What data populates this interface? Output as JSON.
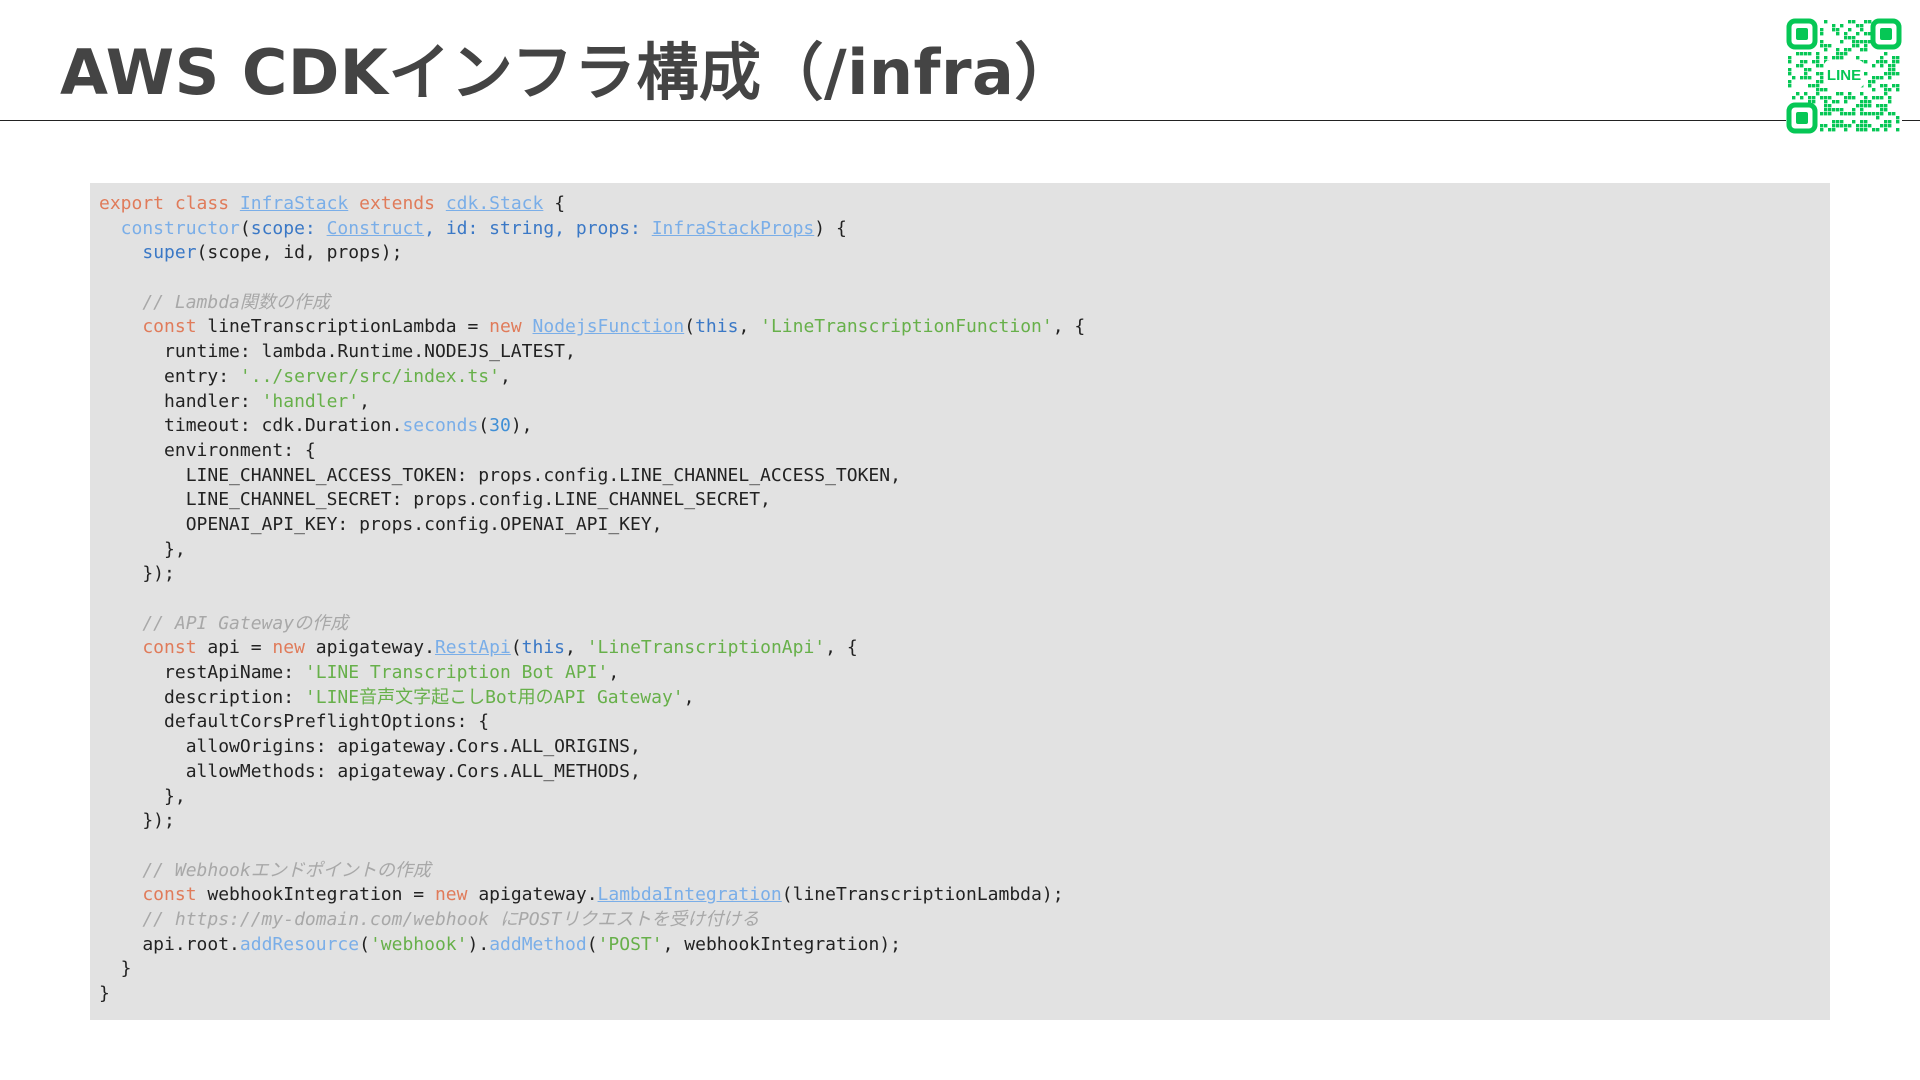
{
  "slide": {
    "title": "AWS CDKインフラ構成（/infra）",
    "qr_label": "LINE"
  },
  "colors": {
    "title": "#444444",
    "panel_background": "#e2e2e2",
    "keyword": "#e07b5a",
    "type_link": "#7aaee8",
    "string": "#67b04a",
    "number": "#3f8fd6",
    "comment": "#a8a8a8",
    "line_green": "#06c755"
  },
  "code": {
    "language": "typescript",
    "lines": [
      [
        [
          "kw",
          "export class "
        ],
        [
          "typ",
          "InfraStack"
        ],
        [
          "kw",
          " extends "
        ],
        [
          "typ",
          "cdk.Stack"
        ],
        [
          "txt",
          " {"
        ]
      ],
      [
        [
          "fn",
          "  constructor"
        ],
        [
          "txt",
          "("
        ],
        [
          "kw2",
          "scope: "
        ],
        [
          "typ",
          "Construct"
        ],
        [
          "kw2",
          ", id: string, props: "
        ],
        [
          "typ",
          "InfraStackProps"
        ],
        [
          "txt",
          ") {"
        ]
      ],
      [
        [
          "txt",
          "    "
        ],
        [
          "kw2",
          "super"
        ],
        [
          "txt",
          "(scope, id, props);"
        ]
      ],
      [],
      [
        [
          "cmt",
          "    // Lambda関数の作成"
        ]
      ],
      [
        [
          "kw",
          "    const"
        ],
        [
          "txt",
          " lineTranscriptionLambda = "
        ],
        [
          "kw",
          "new "
        ],
        [
          "typ",
          "NodejsFunction"
        ],
        [
          "txt",
          "("
        ],
        [
          "kw2",
          "this"
        ],
        [
          "txt",
          ", "
        ],
        [
          "str",
          "'LineTranscriptionFunction'"
        ],
        [
          "txt",
          ", {"
        ]
      ],
      [
        [
          "txt",
          "      runtime: lambda.Runtime.NODEJS_LATEST,"
        ]
      ],
      [
        [
          "txt",
          "      entry: "
        ],
        [
          "str",
          "'../server/src/index.ts'"
        ],
        [
          "txt",
          ","
        ]
      ],
      [
        [
          "txt",
          "      handler: "
        ],
        [
          "str",
          "'handler'"
        ],
        [
          "txt",
          ","
        ]
      ],
      [
        [
          "txt",
          "      timeout: cdk.Duration."
        ],
        [
          "fn",
          "seconds"
        ],
        [
          "txt",
          "("
        ],
        [
          "num",
          "30"
        ],
        [
          "txt",
          "),"
        ]
      ],
      [
        [
          "txt",
          "      environment: {"
        ]
      ],
      [
        [
          "txt",
          "        LINE_CHANNEL_ACCESS_TOKEN: props.config.LINE_CHANNEL_ACCESS_TOKEN,"
        ]
      ],
      [
        [
          "txt",
          "        LINE_CHANNEL_SECRET: props.config.LINE_CHANNEL_SECRET,"
        ]
      ],
      [
        [
          "txt",
          "        OPENAI_API_KEY: props.config.OPENAI_API_KEY,"
        ]
      ],
      [
        [
          "txt",
          "      },"
        ]
      ],
      [
        [
          "txt",
          "    });"
        ]
      ],
      [],
      [
        [
          "cmt",
          "    // API Gatewayの作成"
        ]
      ],
      [
        [
          "kw",
          "    const"
        ],
        [
          "txt",
          " api = "
        ],
        [
          "kw",
          "new"
        ],
        [
          "txt",
          " apigateway."
        ],
        [
          "typ",
          "RestApi"
        ],
        [
          "txt",
          "("
        ],
        [
          "kw2",
          "this"
        ],
        [
          "txt",
          ", "
        ],
        [
          "str",
          "'LineTranscriptionApi'"
        ],
        [
          "txt",
          ", {"
        ]
      ],
      [
        [
          "txt",
          "      restApiName: "
        ],
        [
          "str",
          "'LINE Transcription Bot API'"
        ],
        [
          "txt",
          ","
        ]
      ],
      [
        [
          "txt",
          "      description: "
        ],
        [
          "str",
          "'LINE音声文字起こしBot用のAPI Gateway'"
        ],
        [
          "txt",
          ","
        ]
      ],
      [
        [
          "txt",
          "      defaultCorsPreflightOptions: {"
        ]
      ],
      [
        [
          "txt",
          "        allowOrigins: apigateway.Cors.ALL_ORIGINS,"
        ]
      ],
      [
        [
          "txt",
          "        allowMethods: apigateway.Cors.ALL_METHODS,"
        ]
      ],
      [
        [
          "txt",
          "      },"
        ]
      ],
      [
        [
          "txt",
          "    });"
        ]
      ],
      [],
      [
        [
          "cmt",
          "    // Webhookエンドポイントの作成"
        ]
      ],
      [
        [
          "kw",
          "    const"
        ],
        [
          "txt",
          " webhookIntegration = "
        ],
        [
          "kw",
          "new"
        ],
        [
          "txt",
          " apigateway."
        ],
        [
          "typ",
          "LambdaIntegration"
        ],
        [
          "txt",
          "(lineTranscriptionLambda);"
        ]
      ],
      [
        [
          "cmt",
          "    // https://my-domain.com/webhook にPOSTリクエストを受け付ける"
        ]
      ],
      [
        [
          "txt",
          "    api.root."
        ],
        [
          "fn",
          "addResource"
        ],
        [
          "txt",
          "("
        ],
        [
          "str",
          "'webhook'"
        ],
        [
          "txt",
          ")."
        ],
        [
          "fn",
          "addMethod"
        ],
        [
          "txt",
          "("
        ],
        [
          "str",
          "'POST'"
        ],
        [
          "txt",
          ", webhookIntegration);"
        ]
      ],
      [
        [
          "txt",
          "  }"
        ]
      ],
      [
        [
          "txt",
          "}"
        ]
      ]
    ]
  }
}
